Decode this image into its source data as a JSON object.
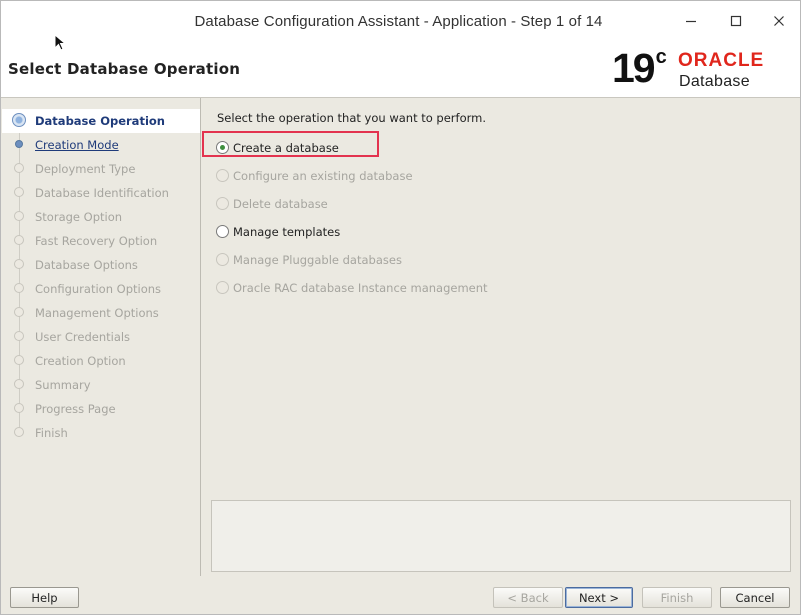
{
  "window": {
    "title": "Database Configuration Assistant - Application - Step 1 of 14",
    "controls": [
      "minimize-icon",
      "maximize-icon",
      "close-icon"
    ]
  },
  "header": {
    "page_title": "Select Database Operation",
    "logo": {
      "version": "19",
      "version_suffix": "c",
      "brand": "ORACLE",
      "product": "Database"
    }
  },
  "steps": [
    {
      "label": "Database Operation",
      "state": "active"
    },
    {
      "label": "Creation Mode",
      "state": "link"
    },
    {
      "label": "Deployment Type",
      "state": "disabled"
    },
    {
      "label": "Database Identification",
      "state": "disabled"
    },
    {
      "label": "Storage Option",
      "state": "disabled"
    },
    {
      "label": "Fast Recovery Option",
      "state": "disabled"
    },
    {
      "label": "Database Options",
      "state": "disabled"
    },
    {
      "label": "Configuration Options",
      "state": "disabled"
    },
    {
      "label": "Management Options",
      "state": "disabled"
    },
    {
      "label": "User Credentials",
      "state": "disabled"
    },
    {
      "label": "Creation Option",
      "state": "disabled"
    },
    {
      "label": "Summary",
      "state": "disabled"
    },
    {
      "label": "Progress Page",
      "state": "disabled"
    },
    {
      "label": "Finish",
      "state": "disabled"
    }
  ],
  "main": {
    "prompt": "Select the operation that you want to perform.",
    "options": [
      {
        "label": "Create a database",
        "checked": true,
        "enabled": true
      },
      {
        "label": "Configure an existing database",
        "checked": false,
        "enabled": false
      },
      {
        "label": "Delete database",
        "checked": false,
        "enabled": false
      },
      {
        "label": "Manage templates",
        "checked": false,
        "enabled": true
      },
      {
        "label": "Manage Pluggable databases",
        "checked": false,
        "enabled": false
      },
      {
        "label": "Oracle RAC database Instance management",
        "checked": false,
        "enabled": false
      }
    ]
  },
  "buttons": {
    "help": "Help",
    "back": "< Back",
    "next": "Next >",
    "finish": "Finish",
    "cancel": "Cancel"
  },
  "colors": {
    "accent": "#1f3b7a",
    "oracle_red": "#e0261c",
    "highlight_box": "#e3334f",
    "disabled_text": "#a6a59f"
  }
}
